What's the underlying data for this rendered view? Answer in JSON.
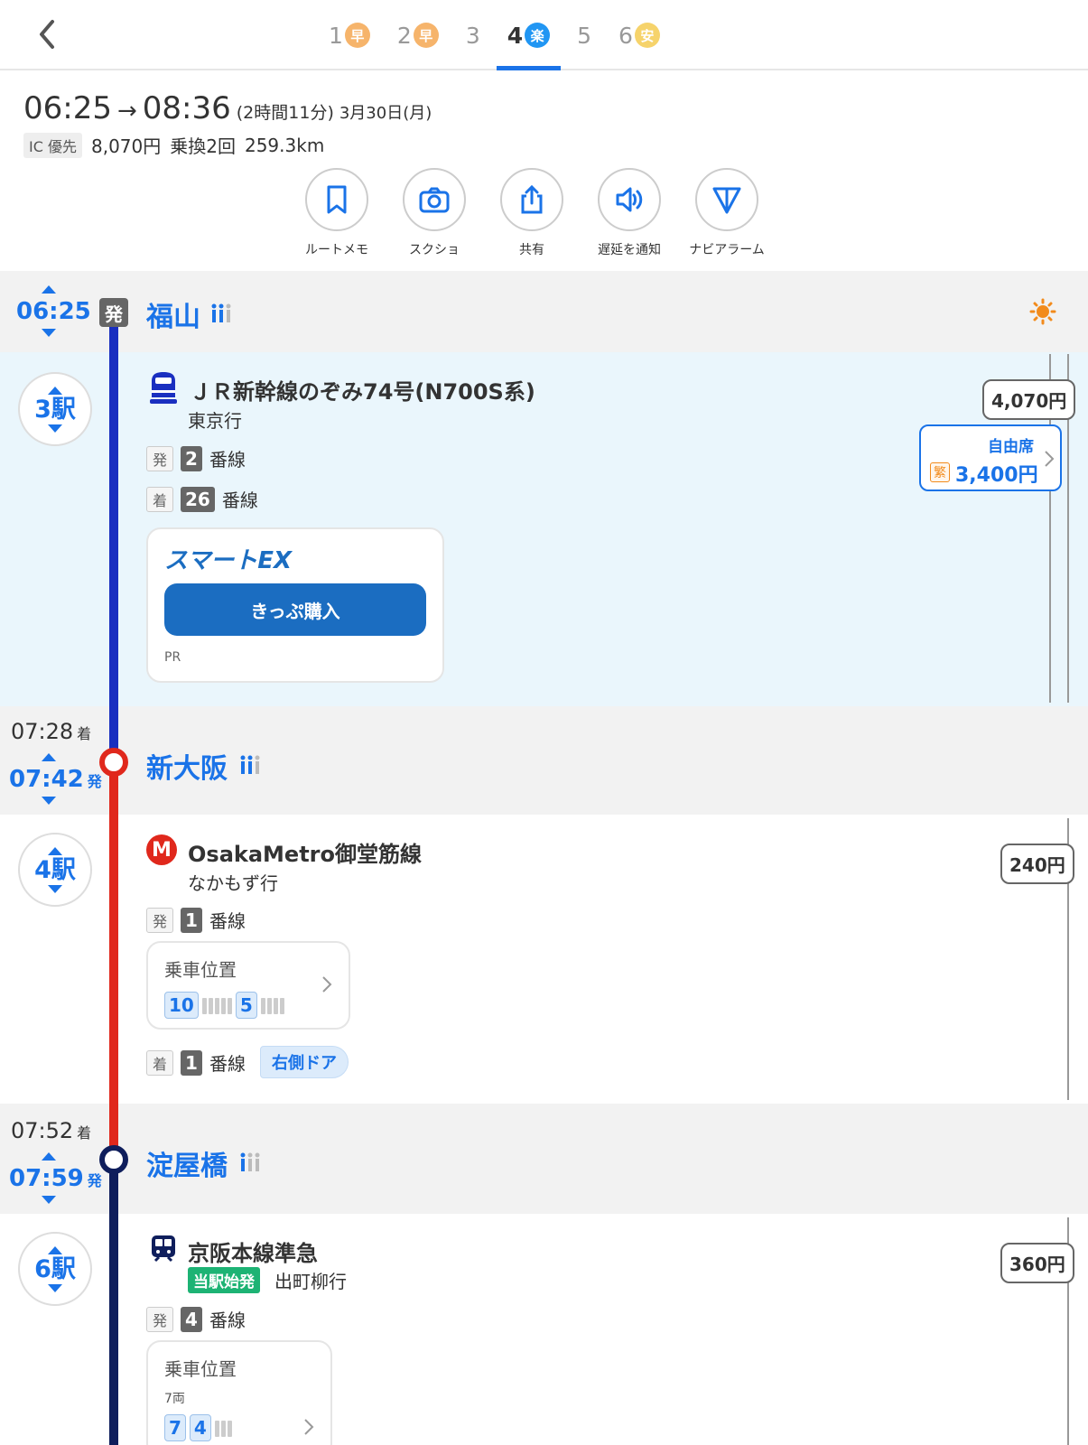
{
  "tabs": [
    {
      "num": "1",
      "badge": "早",
      "badge_color": "#f6b46b"
    },
    {
      "num": "2",
      "badge": "早",
      "badge_color": "#f6b46b"
    },
    {
      "num": "3",
      "badge": "",
      "badge_color": ""
    },
    {
      "num": "4",
      "badge": "楽",
      "badge_color": "#2196f3"
    },
    {
      "num": "5",
      "badge": "",
      "badge_color": ""
    },
    {
      "num": "6",
      "badge": "安",
      "badge_color": "#f6d36b"
    }
  ],
  "active_tab": "4",
  "summary": {
    "depart": "06:25",
    "arrow": "→",
    "arrive": "08:36",
    "duration": "(2時間11分)",
    "date": "3月30日(月)",
    "ic_label": "IC 優先",
    "fare": "8,070円",
    "transfers": "乗換2回",
    "distance": "259.3km"
  },
  "actions": [
    {
      "label": "ルートメモ",
      "icon": "bookmark-icon"
    },
    {
      "label": "スクショ",
      "icon": "camera-icon"
    },
    {
      "label": "共有",
      "icon": "share-icon"
    },
    {
      "label": "遅延を通知",
      "icon": "speaker-icon"
    },
    {
      "label": "ナビアラーム",
      "icon": "navigation-icon"
    }
  ],
  "stations": {
    "fukuyama": {
      "time": "06:25",
      "dep_mark": "発",
      "name": "福山"
    },
    "shinosaka": {
      "arr_time": "07:28",
      "arr_mark": "着",
      "dep_time": "07:42",
      "dep_mark": "発",
      "name": "新大阪"
    },
    "yodoyabashi": {
      "arr_time": "07:52",
      "arr_mark": "着",
      "dep_time": "07:59",
      "dep_mark": "発",
      "name": "淀屋橋"
    }
  },
  "legs": {
    "shinkansen": {
      "stops": "3駅",
      "name": "ＪＲ新幹線のぞみ74号(N700S系)",
      "dest": "東京行",
      "dep_tag": "発",
      "dep_platform": "2",
      "platform_suffix": "番線",
      "arr_tag": "着",
      "arr_platform": "26",
      "fare": "4,070円",
      "seat_label": "自由席",
      "seat_tag": "繁",
      "seat_fare": "3,400円",
      "ad_logo": "スマートEX",
      "ad_button": "きっぷ購入",
      "ad_pr": "PR",
      "line_color": "#1a2fc0"
    },
    "metro": {
      "stops": "4駅",
      "icon_letter": "M",
      "name": "OsakaMetro御堂筋線",
      "dest": "なかもず行",
      "dep_tag": "発",
      "dep_platform": "1",
      "platform_suffix": "番線",
      "board_label": "乗車位置",
      "car_a": "10",
      "car_b": "5",
      "arr_tag": "着",
      "arr_platform": "1",
      "door": "右側ドア",
      "fare": "240円",
      "line_color": "#e0281c"
    },
    "keihan": {
      "stops": "6駅",
      "name": "京阪本線準急",
      "origin_tag": "当駅始発",
      "dest": "出町柳行",
      "dep_tag": "発",
      "dep_platform": "4",
      "platform_suffix": "番線",
      "board_label": "乗車位置",
      "cars": "7両",
      "car_a": "7",
      "car_b": "4",
      "fare": "360円",
      "line_color": "#0f1e5c"
    }
  }
}
